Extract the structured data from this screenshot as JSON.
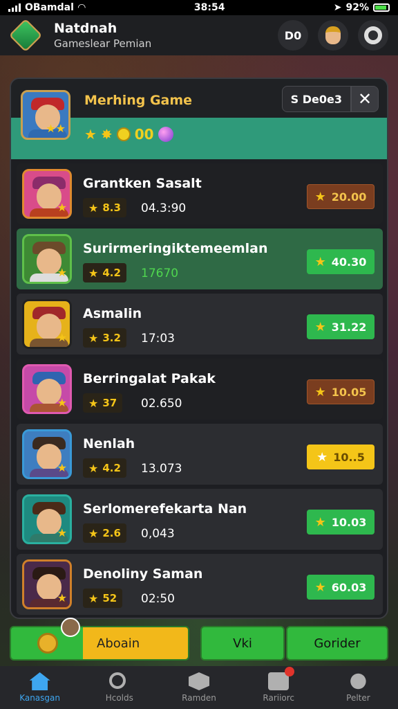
{
  "status_bar": {
    "carrier": "OBamdal",
    "time": "38:54",
    "battery": "92%"
  },
  "header": {
    "title": "Natdnah",
    "subtitle": "Gameslear Pemian",
    "button_text": "D0"
  },
  "featured": {
    "title": "Merhing Game",
    "icons_text": "00",
    "sort_label": "S De0e3",
    "close_label": "✕"
  },
  "rows": [
    {
      "name": "Grantken Sasalt",
      "rating": "8.3",
      "stat": "04.3:90",
      "price": "20.00",
      "hat_color": "#8b2c6a",
      "body_color": "#b8401f",
      "border_color": "#e08a30",
      "bg_color": "#d94c8a",
      "price_style": "brown",
      "row_style": "dark"
    },
    {
      "name": "Surirmeringiktemeemlan",
      "rating": "4.2",
      "stat": "17670",
      "price": "40.30",
      "hat_color": "#6b4a2a",
      "body_color": "#ddd",
      "border_color": "#5fc04a",
      "bg_color": "#3e8a34",
      "price_style": "green",
      "row_style": "green"
    },
    {
      "name": "Asmalin",
      "rating": "3.2",
      "stat": "17:03",
      "price": "31.22",
      "hat_color": "#a0282a",
      "body_color": "#7a5530",
      "border_color": "#222",
      "bg_color": "#e6b21a",
      "price_style": "green",
      "row_style": "normal"
    },
    {
      "name": "Berringalat Pakak",
      "rating": "37",
      "stat": "02.650",
      "price": "10.05",
      "hat_color": "#2f64b0",
      "body_color": "#aa5533",
      "border_color": "#e05ab0",
      "bg_color": "#c64aa8",
      "price_style": "brown",
      "row_style": "dark"
    },
    {
      "name": "Nenlah",
      "rating": "4.2",
      "stat": "13.073",
      "price": "10..5",
      "hat_color": "#3a2a20",
      "body_color": "#5a4a8a",
      "border_color": "#3a9ad8",
      "bg_color": "#3e7ec0",
      "price_style": "yellow",
      "row_style": "normal"
    },
    {
      "name": "Serlomerefekarta Nan",
      "rating": "2.6",
      "stat": "0,043",
      "price": "10.03",
      "hat_color": "#4a2a18",
      "body_color": "#2f7a6a",
      "border_color": "#2ab0a0",
      "bg_color": "#1e8a80",
      "price_style": "green",
      "row_style": "normal"
    },
    {
      "name": "Denoliny Saman",
      "rating": "52",
      "stat": "02:50",
      "price": "60.03",
      "hat_color": "#2a1a14",
      "body_color": "#5a2a30",
      "border_color": "#d0802a",
      "bg_color": "#4a2a4a",
      "price_style": "green",
      "row_style": "normal"
    }
  ],
  "actions": {
    "primary_label": "Aboain",
    "secondary_label": "Vki",
    "tertiary_label": "Gorider"
  },
  "tabs": [
    {
      "label": "Kanasgan",
      "icon": "home-icon",
      "active": true
    },
    {
      "label": "Hcolds",
      "icon": "search-icon",
      "active": false
    },
    {
      "label": "Ramden",
      "icon": "cube-icon",
      "active": false
    },
    {
      "label": "Rariiorc",
      "icon": "notification-box-icon",
      "active": false
    },
    {
      "label": "Pelter",
      "icon": "user-icon",
      "active": false
    }
  ],
  "colors": {
    "accent": "#3ea6f0",
    "gold": "#f5c518",
    "green": "#31b93d",
    "featured_green": "#2f9a7a"
  }
}
